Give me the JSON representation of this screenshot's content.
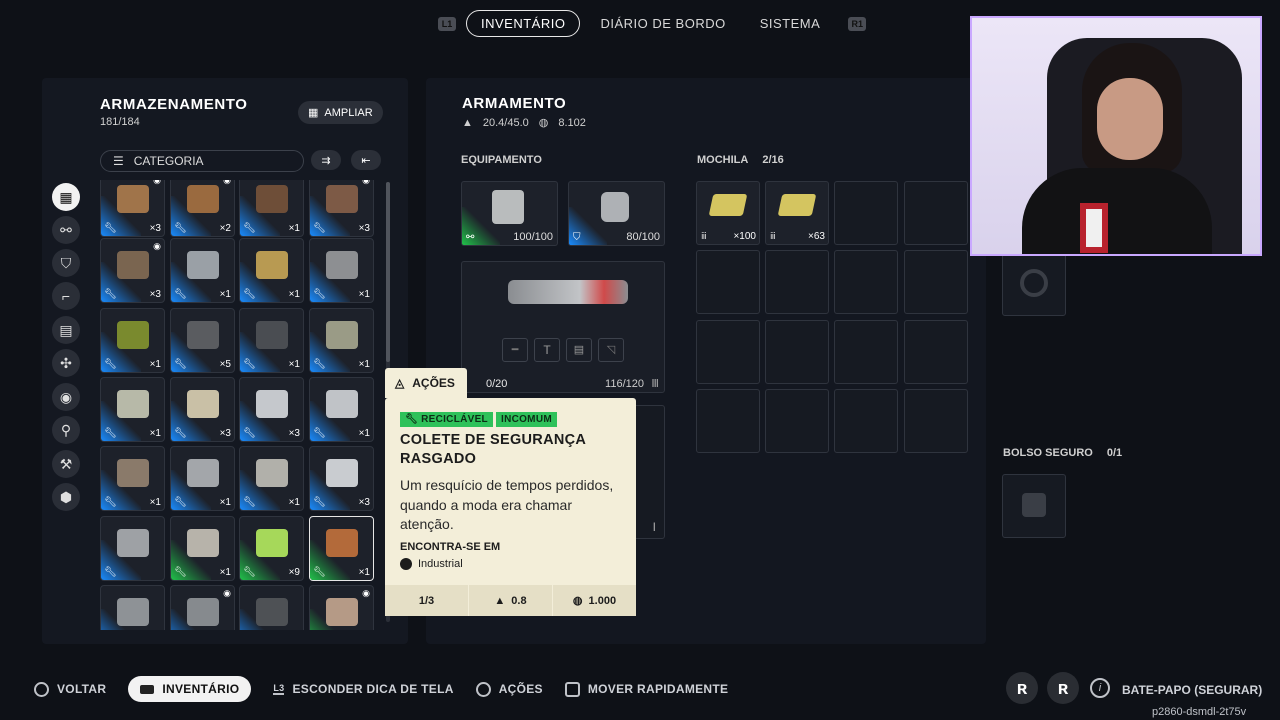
{
  "top_tabs": {
    "left_shoulder": "L1",
    "right_shoulder": "R1",
    "tabs": [
      "INVENTÁRIO",
      "DIÁRIO DE BORDO",
      "SISTEMA"
    ],
    "active": "INVENTÁRIO"
  },
  "storage": {
    "title": "ARMAZENAMENTO",
    "capacity": "181/184",
    "expand_label": "AMPLIAR",
    "filter_label": "CATEGORIA"
  },
  "side_categories": [
    "grid-icon",
    "link-icon",
    "shield-icon",
    "gun-icon",
    "book-icon",
    "gear-icon",
    "disc-icon",
    "wrench-icon",
    "tools-icon",
    "cube-icon"
  ],
  "items": [
    {
      "qty": "×3",
      "rarity": "blue",
      "color": "#a0744a",
      "eye": true
    },
    {
      "qty": "×2",
      "rarity": "blue",
      "color": "#9a6a3f",
      "eye": true
    },
    {
      "qty": "×1",
      "rarity": "blue",
      "color": "#6e4e38",
      "eye": false
    },
    {
      "qty": "×3",
      "rarity": "blue",
      "color": "#7d5a46",
      "eye": true
    },
    {
      "qty": "×3",
      "rarity": "blue",
      "color": "#7a6550",
      "eye": true
    },
    {
      "qty": "×1",
      "rarity": "blue",
      "color": "#9aa0a6",
      "eye": false
    },
    {
      "qty": "×1",
      "rarity": "blue",
      "color": "#b89a52",
      "eye": false
    },
    {
      "qty": "×1",
      "rarity": "blue",
      "color": "#8d8f92",
      "eye": false
    },
    {
      "qty": "×1",
      "rarity": "blue",
      "color": "#7a8a2e",
      "eye": false
    },
    {
      "qty": "×5",
      "rarity": "blue",
      "color": "#5a5c60",
      "eye": false
    },
    {
      "qty": "×1",
      "rarity": "blue",
      "color": "#4a4d52",
      "eye": false
    },
    {
      "qty": "×1",
      "rarity": "blue",
      "color": "#9a9b86",
      "eye": false
    },
    {
      "qty": "×1",
      "rarity": "blue",
      "color": "#b7b9a8",
      "eye": false
    },
    {
      "qty": "×3",
      "rarity": "blue",
      "color": "#c9c0a6",
      "eye": false
    },
    {
      "qty": "×3",
      "rarity": "blue",
      "color": "#c5c8cc",
      "eye": false
    },
    {
      "qty": "×1",
      "rarity": "blue",
      "color": "#c0c3c7",
      "eye": false
    },
    {
      "qty": "×1",
      "rarity": "blue",
      "color": "#8a7a6a",
      "eye": false
    },
    {
      "qty": "×1",
      "rarity": "blue",
      "color": "#a3a6aa",
      "eye": false
    },
    {
      "qty": "×1",
      "rarity": "blue",
      "color": "#b1b0aa",
      "eye": false
    },
    {
      "qty": "×3",
      "rarity": "blue",
      "color": "#c9ccd0",
      "eye": false
    },
    {
      "qty": "",
      "rarity": "blue",
      "color": "#9ea1a5",
      "eye": false
    },
    {
      "qty": "×1",
      "rarity": "green",
      "color": "#b7b3aa",
      "eye": false
    },
    {
      "qty": "×9",
      "rarity": "green",
      "color": "#a6d85a",
      "eye": false
    },
    {
      "qty": "×1",
      "rarity": "green",
      "color": "#b36a3a",
      "eye": false
    },
    {
      "qty": "",
      "rarity": "blue",
      "color": "#8e9296",
      "eye": false
    },
    {
      "qty": "",
      "rarity": "blue",
      "color": "#868a8e",
      "eye": true
    },
    {
      "qty": "",
      "rarity": "blue",
      "color": "#4e5155",
      "eye": false
    },
    {
      "qty": "",
      "rarity": "green",
      "color": "#b59a86",
      "eye": true
    }
  ],
  "loadout": {
    "title": "ARMAMENTO",
    "weight": "20.4/45.0",
    "credits": "8.102",
    "equipment_label": "EQUIPAMENTO",
    "shield_value": "100/100",
    "armor_value": "80/100",
    "weapon_ammo_left": "0/20",
    "weapon_ammo_right": "116/120"
  },
  "backpack": {
    "label": "MOCHILA",
    "count": "2/16",
    "items": [
      {
        "qty": "×100"
      },
      {
        "qty": "×63"
      }
    ]
  },
  "safe_pocket": {
    "label": "BOLSO SEGURO",
    "count": "0/1"
  },
  "actions_label": "AÇÕES",
  "tooltip": {
    "tags": [
      "RECICLÁVEL",
      "INCOMUM"
    ],
    "title": "COLETE DE SEGURANÇA RASGADO",
    "description": "Um resquício de tempos perdidos, quando a moda era chamar atenção.",
    "found_label": "ENCONTRA-SE EM",
    "found_place": "Industrial",
    "stack": "1/3",
    "weight": "0.8",
    "price": "1.000"
  },
  "bottom_bar": {
    "back": "VOLTAR",
    "inventory": "INVENTÁRIO",
    "hint_key": "L3",
    "hide_hint": "ESCONDER DICA DE TELA",
    "actions": "AÇÕES",
    "quick_move": "MOVER RAPIDAMENTE",
    "chat": "BATE-PAPO (SEGURAR)"
  },
  "watermark": "p2860-dsmdl-2t75v"
}
